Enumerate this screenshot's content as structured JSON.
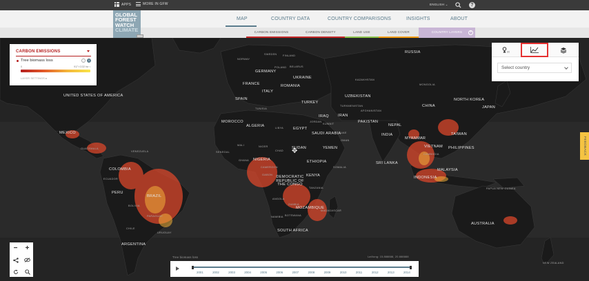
{
  "topbar": {
    "apps_label": "APPS",
    "more_label": "MORE IN GFW",
    "language": "ENGLISH",
    "help_symbol": "?"
  },
  "logo": {
    "line1": "GLOBAL",
    "line2": "FOREST",
    "line3": "WATCH",
    "line4": "CLIMATE"
  },
  "nav": {
    "items": [
      {
        "label": "MAP",
        "active": true
      },
      {
        "label": "COUNTRY DATA"
      },
      {
        "label": "COUNTRY COMPARISONS"
      },
      {
        "label": "INSIGHTS"
      },
      {
        "label": "ABOUT"
      }
    ]
  },
  "layer_tabs": [
    {
      "label": "CARBON EMISSIONS",
      "color": "#c62828"
    },
    {
      "label": "CARBON DENSITY",
      "color": "#c62828"
    },
    {
      "label": "LAND USE",
      "color": "#8bc34a"
    },
    {
      "label": "LAND COVER",
      "color": "#f39c12"
    },
    {
      "label": "COUNTRY LAYERS",
      "color": "#c9b6d6"
    }
  ],
  "legend": {
    "title": "CARBON EMISSIONS",
    "layer": "Tree biomass loss",
    "range_low": "0",
    "range_high": "917 t CO2 ha⁻¹",
    "settings": "LAYER SETTINGS",
    "accent": "#b51f1f"
  },
  "analysis_panel": {
    "select_placeholder": "Select country",
    "tabs": [
      {
        "icon": "analysis-pin-icon"
      },
      {
        "icon": "line-chart-icon",
        "active": true
      },
      {
        "icon": "layers-icon"
      }
    ]
  },
  "feedback_label": "FEEDBACK",
  "map": {
    "labels": [
      {
        "text": "UNITED STATES OF AMERICA",
        "kind": "country"
      },
      {
        "text": "MEXICO",
        "kind": "country"
      },
      {
        "text": "GUATEMALA",
        "kind": "small"
      },
      {
        "text": "VENEZUELA",
        "kind": "small"
      },
      {
        "text": "COLOMBIA",
        "kind": "country"
      },
      {
        "text": "ECUADOR",
        "kind": "small"
      },
      {
        "text": "PERU",
        "kind": "country"
      },
      {
        "text": "BRAZIL",
        "kind": "country"
      },
      {
        "text": "BOLIVIA",
        "kind": "small"
      },
      {
        "text": "PARAGUAY",
        "kind": "small"
      },
      {
        "text": "CHILE",
        "kind": "small"
      },
      {
        "text": "URUGUAY",
        "kind": "small"
      },
      {
        "text": "ARGENTINA",
        "kind": "country"
      },
      {
        "text": "NORWAY",
        "kind": "small"
      },
      {
        "text": "SWEDEN",
        "kind": "small"
      },
      {
        "text": "FINLAND",
        "kind": "small"
      },
      {
        "text": "BELARUS",
        "kind": "small"
      },
      {
        "text": "POLAND",
        "kind": "small"
      },
      {
        "text": "GERMANY",
        "kind": "country"
      },
      {
        "text": "UKRAINE",
        "kind": "country"
      },
      {
        "text": "FRANCE",
        "kind": "country"
      },
      {
        "text": "ROMANIA",
        "kind": "country"
      },
      {
        "text": "ITALY",
        "kind": "country"
      },
      {
        "text": "SPAIN",
        "kind": "country"
      },
      {
        "text": "TURKEY",
        "kind": "country"
      },
      {
        "text": "TUNISIA",
        "kind": "small"
      },
      {
        "text": "MOROCCO",
        "kind": "country"
      },
      {
        "text": "ALGERIA",
        "kind": "country"
      },
      {
        "text": "LIBYA",
        "kind": "small"
      },
      {
        "text": "EGYPT",
        "kind": "country"
      },
      {
        "text": "IRAQ",
        "kind": "country"
      },
      {
        "text": "IRAN",
        "kind": "country"
      },
      {
        "text": "JORDAN",
        "kind": "small"
      },
      {
        "text": "KUWAIT",
        "kind": "small"
      },
      {
        "text": "SAUDI ARABIA",
        "kind": "country"
      },
      {
        "text": "UAE",
        "kind": "small"
      },
      {
        "text": "OMAN",
        "kind": "small"
      },
      {
        "text": "YEMEN",
        "kind": "country"
      },
      {
        "text": "MALI",
        "kind": "small"
      },
      {
        "text": "NIGER",
        "kind": "small"
      },
      {
        "text": "CHAD",
        "kind": "small"
      },
      {
        "text": "SUDAN",
        "kind": "country"
      },
      {
        "text": "SENEGAL",
        "kind": "small"
      },
      {
        "text": "NIGERIA",
        "kind": "country"
      },
      {
        "text": "GHANA",
        "kind": "small"
      },
      {
        "text": "CAMEROON",
        "kind": "small"
      },
      {
        "text": "GABON",
        "kind": "small"
      },
      {
        "text": "ETHIOPIA",
        "kind": "country"
      },
      {
        "text": "SOMALIA",
        "kind": "small"
      },
      {
        "text": "KENYA",
        "kind": "country"
      },
      {
        "text": "DEMOCRATIC REPUBLIC OF THE CONGO",
        "kind": "country"
      },
      {
        "text": "TANZANIA",
        "kind": "small"
      },
      {
        "text": "ANGOLA",
        "kind": "small"
      },
      {
        "text": "ZAMBIA",
        "kind": "small"
      },
      {
        "text": "NAMIBIA",
        "kind": "small"
      },
      {
        "text": "BOTSWANA",
        "kind": "small"
      },
      {
        "text": "MOZAMBIQUE",
        "kind": "country"
      },
      {
        "text": "MADAGASCAR",
        "kind": "small"
      },
      {
        "text": "SOUTH AFRICA",
        "kind": "country"
      },
      {
        "text": "RUSSIA",
        "kind": "country"
      },
      {
        "text": "KAZAKHSTAN",
        "kind": "small"
      },
      {
        "text": "UZBEKISTAN",
        "kind": "country"
      },
      {
        "text": "TURKMENISTAN",
        "kind": "small"
      },
      {
        "text": "AFGHANISTAN",
        "kind": "small"
      },
      {
        "text": "PAKISTAN",
        "kind": "country"
      },
      {
        "text": "INDIA",
        "kind": "country"
      },
      {
        "text": "NEPAL",
        "kind": "country"
      },
      {
        "text": "SRI LANKA",
        "kind": "country"
      },
      {
        "text": "MONGOLIA",
        "kind": "small"
      },
      {
        "text": "CHINA",
        "kind": "country"
      },
      {
        "text": "NORTH KOREA",
        "kind": "country"
      },
      {
        "text": "JAPAN",
        "kind": "country"
      },
      {
        "text": "MYANMAR",
        "kind": "country"
      },
      {
        "text": "VIETNAM",
        "kind": "country"
      },
      {
        "text": "TAIWAN",
        "kind": "country"
      },
      {
        "text": "PHILIPPINES",
        "kind": "country"
      },
      {
        "text": "CAMBODIA",
        "kind": "small"
      },
      {
        "text": "MALAYSIA",
        "kind": "country"
      },
      {
        "text": "INDONESIA",
        "kind": "country"
      },
      {
        "text": "PAPUA NEW GUINEA",
        "kind": "small"
      },
      {
        "text": "AUSTRALIA",
        "kind": "country"
      },
      {
        "text": "NEW ZEALAND",
        "kind": "small"
      }
    ]
  },
  "timeline": {
    "caption": "Tree biomass loss",
    "latlng": "Lat/long: 15.888888, 20.888888",
    "years": [
      "2001",
      "2002",
      "2003",
      "2004",
      "2005",
      "2006",
      "2007",
      "2008",
      "2009",
      "2010",
      "2011",
      "2012",
      "2013",
      "2014"
    ]
  }
}
